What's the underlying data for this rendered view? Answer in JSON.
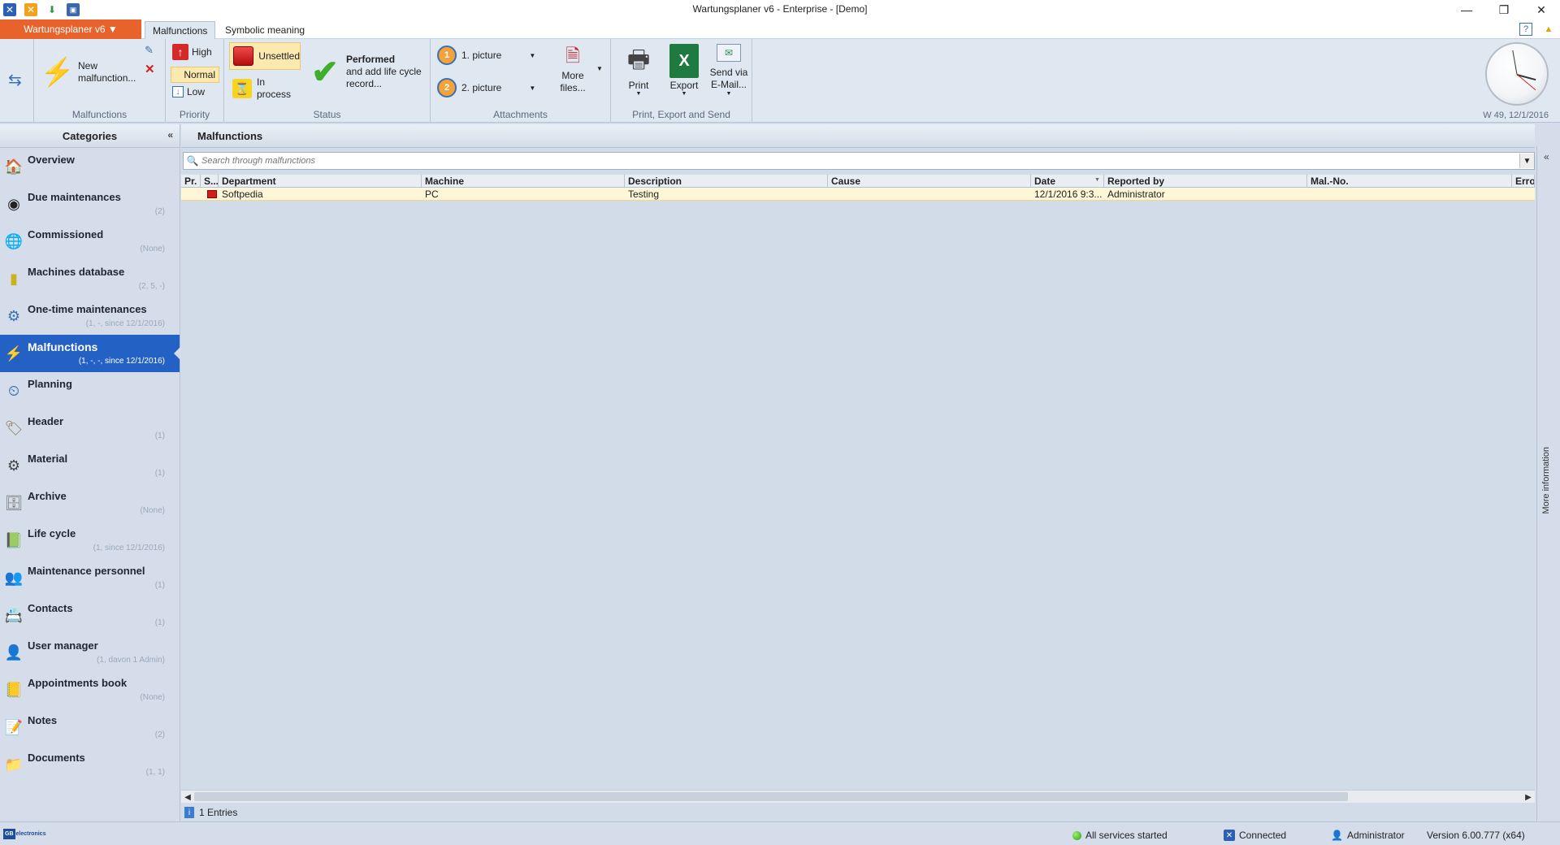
{
  "window": {
    "title": "Wartungsplaner v6 - Enterprise - [Demo]",
    "controls": {
      "minimize": "—",
      "restore": "❐",
      "close": "✕"
    }
  },
  "tabs": {
    "app_menu": "Wartungsplaner v6 ▼",
    "items": [
      {
        "label": "Malfunctions",
        "active": true
      },
      {
        "label": "Symbolic meaning",
        "active": false
      }
    ]
  },
  "ribbon": {
    "malfunctions_group": {
      "label": "Malfunctions",
      "new_line1": "New",
      "new_line2": "malfunction..."
    },
    "priority_group": {
      "label": "Priority",
      "high": "High",
      "normal": "Normal",
      "low": "Low"
    },
    "status_group": {
      "label": "Status",
      "unsettled": "Unsettled",
      "in_process_line1": "In",
      "in_process_line2": "process",
      "performed_line1": "Performed",
      "performed_line2": "and add life cycle",
      "performed_line3": "record..."
    },
    "attachments_group": {
      "label": "Attachments",
      "picture1": "1. picture",
      "picture2": "2. picture",
      "more_line1": "More",
      "more_line2": "files..."
    },
    "print_group": {
      "label": "Print, Export and Send",
      "print": "Print",
      "export": "Export",
      "send_line1": "Send via",
      "send_line2": "E-Mail..."
    },
    "clock": {
      "week": "W 49, 12/1/2016"
    }
  },
  "categories": {
    "title": "Categories",
    "items": [
      {
        "label": "Overview",
        "sub": "",
        "icon": "home-icon",
        "glyph": "🏠",
        "active": false
      },
      {
        "label": "Due maintenances",
        "sub": "(2)",
        "icon": "clock-icon",
        "glyph": "◉",
        "active": false
      },
      {
        "label": "Commissioned",
        "sub": "(None)",
        "icon": "globe-icon",
        "glyph": "🌐",
        "active": false
      },
      {
        "label": "Machines database",
        "sub": "(2, 5, -)",
        "icon": "database-icon",
        "glyph": "▮",
        "active": false
      },
      {
        "label": "One-time maintenances",
        "sub": "(1, -, since 12/1/2016)",
        "icon": "tools-icon",
        "glyph": "⚙",
        "active": false
      },
      {
        "label": "Malfunctions",
        "sub": "(1, -, -, since 12/1/2016)",
        "icon": "lightning-icon",
        "glyph": "⚡",
        "active": true
      },
      {
        "label": "Planning",
        "sub": "",
        "icon": "planning-icon",
        "glyph": "⏲",
        "active": false
      },
      {
        "label": "Header",
        "sub": "(1)",
        "icon": "tag-icon",
        "glyph": "🏷",
        "active": false
      },
      {
        "label": "Material",
        "sub": "(1)",
        "icon": "material-icon",
        "glyph": "⚙",
        "active": false
      },
      {
        "label": "Archive",
        "sub": "(None)",
        "icon": "archive-icon",
        "glyph": "🗄",
        "active": false
      },
      {
        "label": "Life cycle",
        "sub": "(1, since 12/1/2016)",
        "icon": "lifecycle-icon",
        "glyph": "📗",
        "active": false
      },
      {
        "label": "Maintenance  personnel",
        "sub": "(1)",
        "icon": "personnel-icon",
        "glyph": "👥",
        "active": false
      },
      {
        "label": "Contacts",
        "sub": "(1)",
        "icon": "contacts-icon",
        "glyph": "📇",
        "active": false
      },
      {
        "label": "User manager",
        "sub": "(1, davon 1 Admin)",
        "icon": "user-icon",
        "glyph": "👤",
        "active": false
      },
      {
        "label": "Appointments  book",
        "sub": "(None)",
        "icon": "book-icon",
        "glyph": "📒",
        "active": false
      },
      {
        "label": "Notes",
        "sub": "(2)",
        "icon": "notes-icon",
        "glyph": "📝",
        "active": false
      },
      {
        "label": "Documents",
        "sub": "(1, 1)",
        "icon": "documents-icon",
        "glyph": "📁",
        "active": false
      }
    ]
  },
  "main": {
    "title": "Malfunctions",
    "search_placeholder": "Search through malfunctions",
    "columns": [
      "Pr.",
      "S...",
      "Department",
      "Machine",
      "Description",
      "Cause",
      "Date",
      "Reported by",
      "Mal.-No.",
      "Error"
    ],
    "rows": [
      {
        "department": "Softpedia",
        "machine": "PC",
        "description": "Testing",
        "cause": "",
        "date": "12/1/2016 9:3...",
        "reported_by": "Administrator",
        "mal_no": "",
        "error": ""
      }
    ],
    "entries": "1 Entries"
  },
  "right_panel": {
    "label": "More information"
  },
  "statusbar": {
    "logo": "GB",
    "logo_text": "electronics",
    "services": "All services started",
    "connection": "Connected",
    "user": "Administrator",
    "version": "Version 6.00.777 (x64)"
  }
}
